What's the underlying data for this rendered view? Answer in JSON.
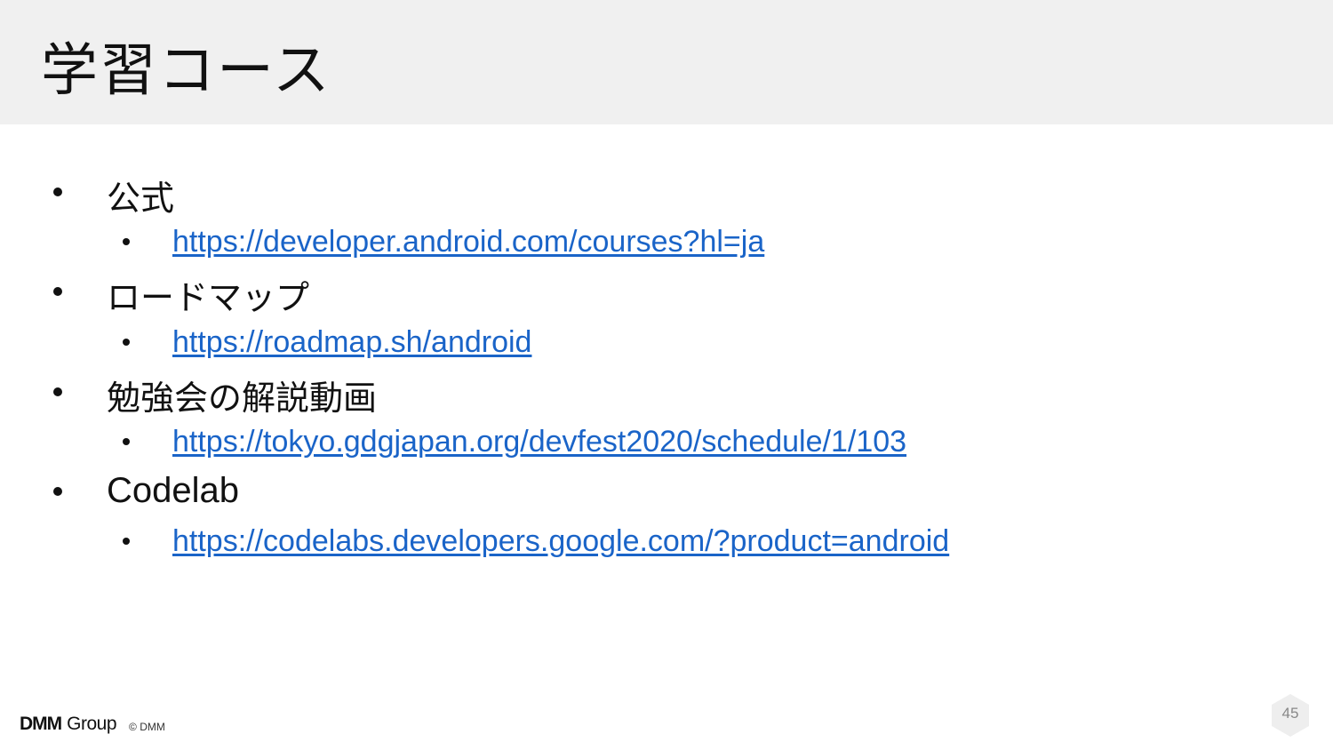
{
  "slide": {
    "title": "学習コース"
  },
  "sections": [
    {
      "label": "公式",
      "link": "https://developer.android.com/courses?hl=ja"
    },
    {
      "label": "ロードマップ",
      "link": "https://roadmap.sh/android"
    },
    {
      "label": "勉強会の解説動画",
      "link": "https://tokyo.gdgjapan.org/devfest2020/schedule/1/103"
    },
    {
      "label": "Codelab",
      "link": "https://codelabs.developers.google.com/?product=android"
    }
  ],
  "footer": {
    "logo_mark": "DMM",
    "logo_group": "Group",
    "copyright": "© DMM",
    "page_number": "45"
  },
  "colors": {
    "title_bar_bg": "#f0f0f0",
    "link": "#1a64c8",
    "text": "#111111",
    "badge": "#eeeeee"
  }
}
